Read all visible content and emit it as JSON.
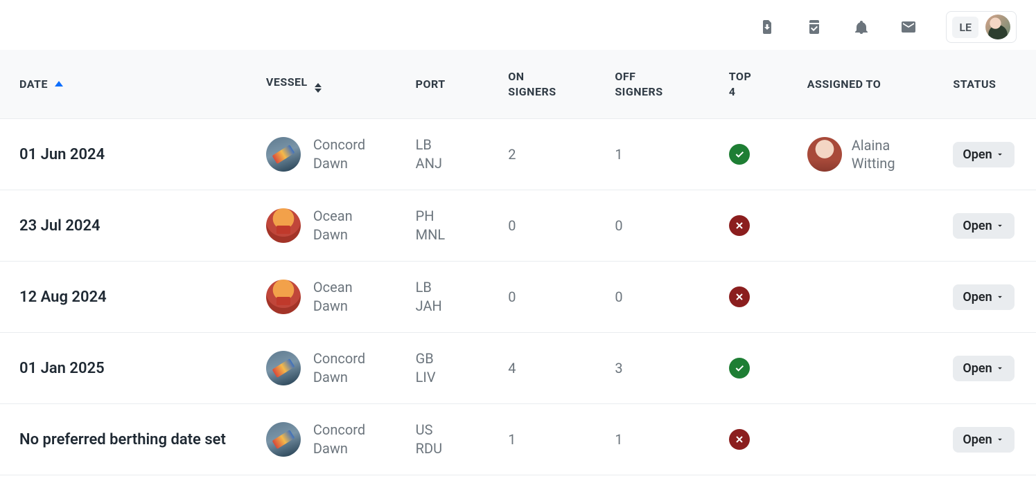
{
  "topbar": {
    "user_initials": "LE"
  },
  "columns": {
    "date": "DATE",
    "vessel": "VESSEL",
    "port": "PORT",
    "on_l1": "ON",
    "on_l2": "SIGNERS",
    "off_l1": "OFF",
    "off_l2": "SIGNERS",
    "top4_l1": "TOP",
    "top4_l2": "4",
    "assigned": "ASSIGNED TO",
    "status": "STATUS"
  },
  "rows": [
    {
      "date": "01 Jun 2024",
      "vessel_l1": "Concord",
      "vessel_l2": "Dawn",
      "vessel_kind": "concord",
      "port_l1": "LB",
      "port_l2": "ANJ",
      "on": "2",
      "off": "1",
      "top4": true,
      "assignee_l1": "Alaina",
      "assignee_l2": "Witting",
      "status_label": "Open"
    },
    {
      "date": "23 Jul 2024",
      "vessel_l1": "Ocean",
      "vessel_l2": "Dawn",
      "vessel_kind": "ocean",
      "port_l1": "PH",
      "port_l2": "MNL",
      "on": "0",
      "off": "0",
      "top4": false,
      "assignee_l1": "",
      "assignee_l2": "",
      "status_label": "Open"
    },
    {
      "date": "12 Aug 2024",
      "vessel_l1": "Ocean",
      "vessel_l2": "Dawn",
      "vessel_kind": "ocean",
      "port_l1": "LB",
      "port_l2": "JAH",
      "on": "0",
      "off": "0",
      "top4": false,
      "assignee_l1": "",
      "assignee_l2": "",
      "status_label": "Open"
    },
    {
      "date": "01 Jan 2025",
      "vessel_l1": "Concord",
      "vessel_l2": "Dawn",
      "vessel_kind": "concord",
      "port_l1": "GB",
      "port_l2": "LIV",
      "on": "4",
      "off": "3",
      "top4": true,
      "assignee_l1": "",
      "assignee_l2": "",
      "status_label": "Open"
    },
    {
      "date": "No preferred berthing date set",
      "vessel_l1": "Concord",
      "vessel_l2": "Dawn",
      "vessel_kind": "concord",
      "port_l1": "US",
      "port_l2": "RDU",
      "on": "1",
      "off": "1",
      "top4": false,
      "assignee_l1": "",
      "assignee_l2": "",
      "status_label": "Open"
    }
  ]
}
